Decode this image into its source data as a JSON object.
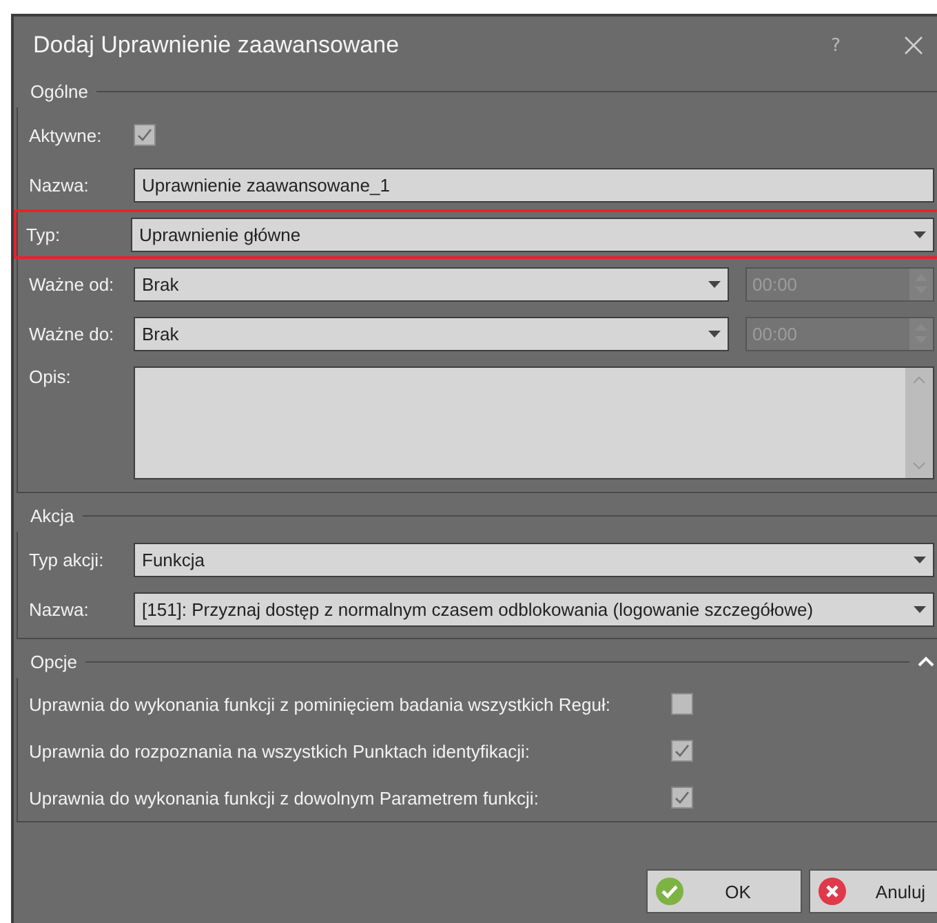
{
  "window": {
    "title": "Dodaj Uprawnienie zaawansowane",
    "help_button": "?"
  },
  "sections": [
    {
      "title": "Ogólne",
      "rows": [
        {
          "kind": "checkbox",
          "label": "Aktywne:",
          "checked": true,
          "highlighted": false
        },
        {
          "kind": "text",
          "label": "Nazwa:",
          "value": "Uprawnienie zaawansowane_1",
          "highlighted": false
        },
        {
          "kind": "dropdown",
          "label": "Typ:",
          "value": "Uprawnienie główne",
          "highlighted": true
        },
        {
          "kind": "date",
          "label": "Ważne od:",
          "value": "Brak",
          "time": "00:00",
          "highlighted": false
        },
        {
          "kind": "date",
          "label": "Ważne do:",
          "value": "Brak",
          "time": "00:00",
          "highlighted": false
        },
        {
          "kind": "memo",
          "label": "Opis:",
          "highlighted": false
        }
      ]
    },
    {
      "title": "Akcja",
      "rows": [
        {
          "kind": "dropdown",
          "label": "Typ akcji:",
          "value": "Funkcja",
          "highlighted": false
        },
        {
          "kind": "dropdown",
          "label": "Nazwa:",
          "value": "[151]: Przyznaj dostęp z normalnym czasem odblokowania (logowanie szczegółowe)",
          "highlighted": false
        }
      ]
    },
    {
      "title": "Opcje",
      "expanded": true,
      "rows": [
        {
          "kind": "option",
          "label": "Uprawnia do wykonania funkcji z pominięciem badania wszystkich Reguł:",
          "checked": false,
          "highlighted": false
        },
        {
          "kind": "option",
          "label": "Uprawnia do rozpoznania na wszystkich Punktach identyfikacji:",
          "checked": true,
          "highlighted": false
        },
        {
          "kind": "option",
          "label": "Uprawnia do wykonania funkcji z dowolnym Parametrem funkcji:",
          "checked": true,
          "highlighted": false
        }
      ]
    }
  ],
  "buttons": [
    {
      "kind": "ok",
      "label": "OK"
    },
    {
      "kind": "cancel",
      "label": "Anuluj"
    }
  ]
}
